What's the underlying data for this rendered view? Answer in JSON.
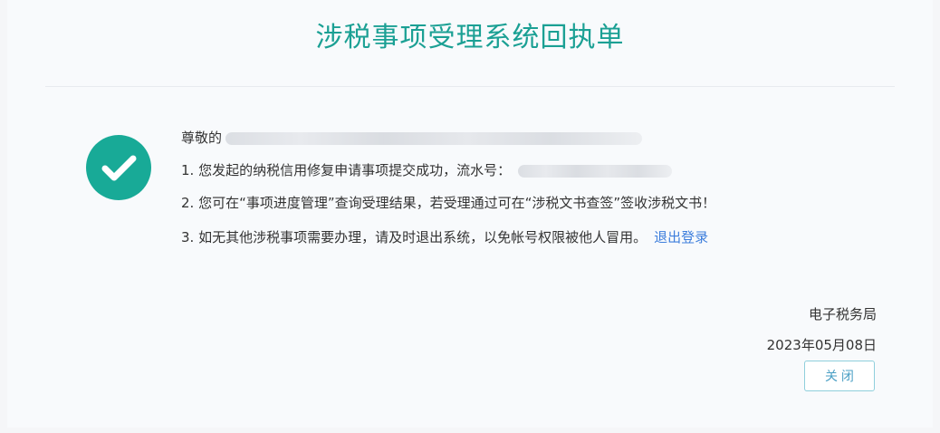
{
  "header": {
    "title": "涉税事项受理系统回执单"
  },
  "icon": {
    "success": "check-circle-icon",
    "color": "#18aa97"
  },
  "message": {
    "greeting_prefix": "尊敬的",
    "line1_prefix": "1. 您发起的纳税信用修复申请事项提交成功，流水号：",
    "line2": "2. 您可在“事项进度管理”查询受理结果，若受理通过可在“涉税文书查签”签收涉税文书！",
    "line3_prefix": "3. 如无其他涉税事项需要办理，请及时退出系统，以免帐号权限被他人冒用。",
    "logout_link": "退出登录"
  },
  "footer": {
    "office": "电子税务局",
    "date": "2023年05月08日",
    "close_label": "关 闭"
  },
  "colors": {
    "title": "#1ba094",
    "link": "#3d7edc",
    "button_border": "#8fcfdc"
  }
}
